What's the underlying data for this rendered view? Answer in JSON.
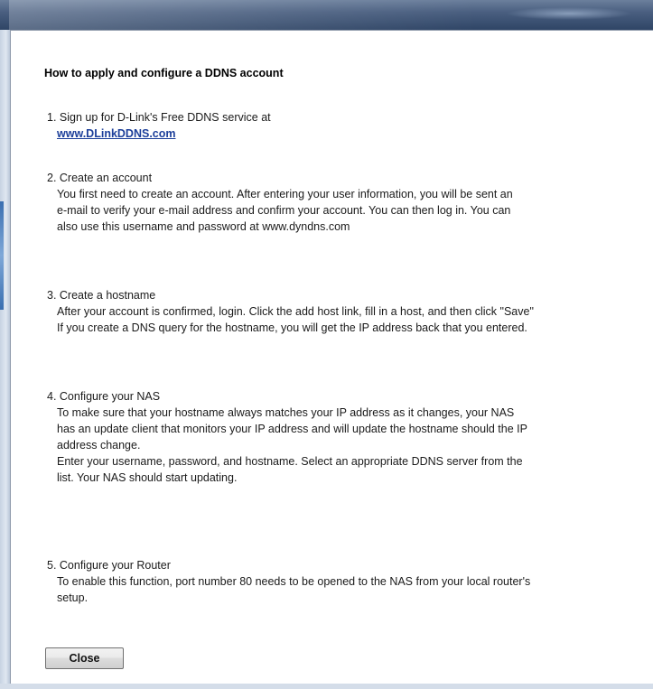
{
  "dialog": {
    "heading": "How to apply and configure a DDNS account",
    "close_label": "Close"
  },
  "steps": [
    {
      "title": "1. Sign up for D-Link's Free DDNS service at",
      "link": "www.DLinkDDNS.com"
    },
    {
      "title": "2. Create an account",
      "lines": [
        "You first need to create an account. After entering your user information, you will be sent an",
        "e-mail to verify your e-mail address and confirm your account. You can then log in. You can",
        "also use this username and password at www.dyndns.com"
      ]
    },
    {
      "title": "3. Create a hostname",
      "lines": [
        "After your account is confirmed, login. Click the add host link, fill in a host, and then click \"Save\"",
        "If you create a DNS query for the hostname, you will get the IP address back that you entered."
      ]
    },
    {
      "title": "4. Configure your NAS",
      "lines": [
        "To make sure that your hostname always matches your IP address as it changes, your NAS",
        "has an update client that monitors your IP address and will update the hostname should the IP",
        "address change.",
        "Enter your username, password, and hostname. Select an appropriate DDNS server from the",
        "list. Your NAS should start updating."
      ]
    },
    {
      "title": "5. Configure your Router",
      "lines": [
        "To enable this function, port number 80 needs to be opened to the NAS from your local router's",
        "setup."
      ]
    }
  ],
  "colors": {
    "link": "#1c3f9a",
    "titlebar": "#4a5f80"
  }
}
